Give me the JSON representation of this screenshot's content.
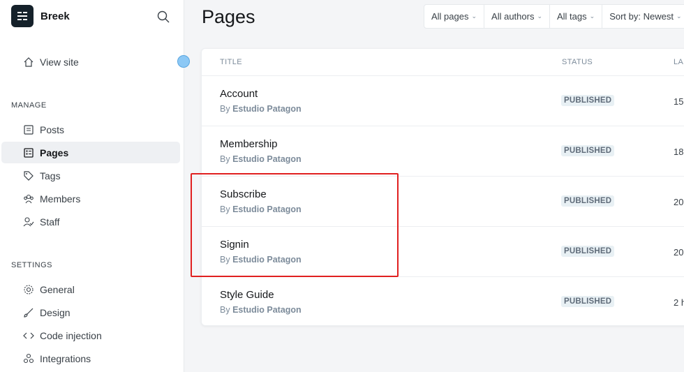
{
  "brand": {
    "name": "Breek"
  },
  "sidebar": {
    "view_site": "View site",
    "manage_label": "MANAGE",
    "manage_items": [
      {
        "label": "Posts",
        "icon": "posts-icon"
      },
      {
        "label": "Pages",
        "icon": "pages-icon",
        "active": true
      },
      {
        "label": "Tags",
        "icon": "tag-icon"
      },
      {
        "label": "Members",
        "icon": "members-icon"
      },
      {
        "label": "Staff",
        "icon": "staff-icon"
      }
    ],
    "settings_label": "SETTINGS",
    "settings_items": [
      {
        "label": "General",
        "icon": "gear-icon"
      },
      {
        "label": "Design",
        "icon": "brush-icon"
      },
      {
        "label": "Code injection",
        "icon": "code-icon"
      },
      {
        "label": "Integrations",
        "icon": "integrations-icon"
      }
    ]
  },
  "main": {
    "title": "Pages",
    "filters": [
      "All pages",
      "All authors",
      "All tags",
      "Sort by: Newest"
    ],
    "columns": {
      "title": "TITLE",
      "status": "STATUS",
      "last": "LAS"
    },
    "rows": [
      {
        "title": "Account",
        "by": "By",
        "author": "Estudio Patagon",
        "status": "PUBLISHED",
        "last": "15"
      },
      {
        "title": "Membership",
        "by": "By",
        "author": "Estudio Patagon",
        "status": "PUBLISHED",
        "last": "18"
      },
      {
        "title": "Subscribe",
        "by": "By",
        "author": "Estudio Patagon",
        "status": "PUBLISHED",
        "last": "20"
      },
      {
        "title": "Signin",
        "by": "By",
        "author": "Estudio Patagon",
        "status": "PUBLISHED",
        "last": "20"
      },
      {
        "title": "Style Guide",
        "by": "By",
        "author": "Estudio Patagon",
        "status": "PUBLISHED",
        "last": "2 h"
      }
    ]
  },
  "colors": {
    "highlight": "#e02020",
    "status_dot": "#8cc8f5",
    "active_bg": "#eef0f3"
  }
}
